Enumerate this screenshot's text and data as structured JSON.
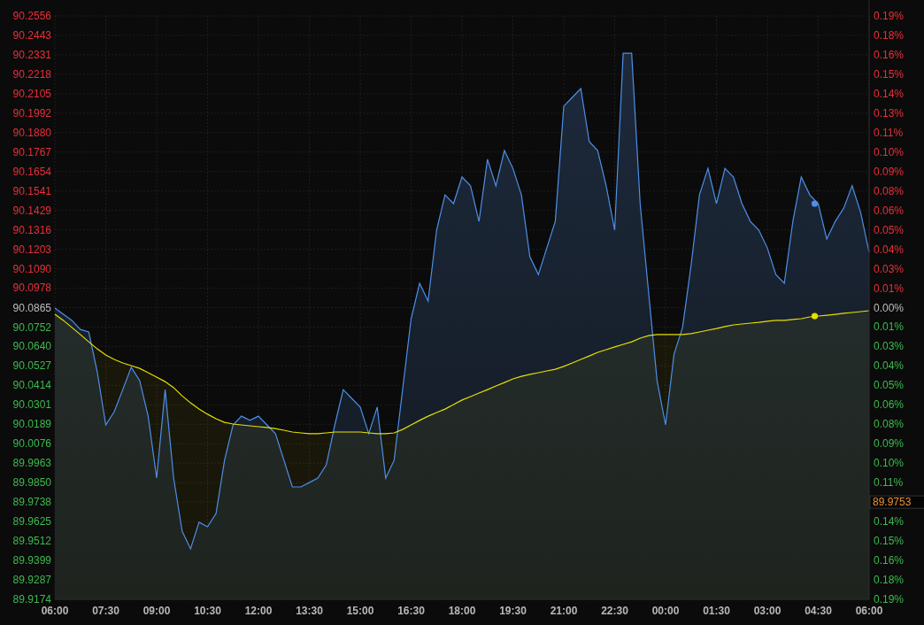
{
  "chart": {
    "chart_data": {
      "type": "area",
      "grid": true,
      "ylim": [
        89.9174,
        90.2556
      ],
      "categories": [
        "06:00",
        null,
        null,
        null,
        null,
        null,
        "07:30",
        null,
        null,
        null,
        null,
        null,
        "09:00",
        null,
        null,
        null,
        null,
        null,
        "10:30",
        null,
        null,
        null,
        null,
        null,
        "12:00",
        null,
        null,
        null,
        null,
        null,
        "13:30",
        null,
        null,
        null,
        null,
        null,
        "15:00",
        null,
        null,
        null,
        null,
        null,
        "16:30",
        null,
        null,
        null,
        null,
        null,
        "18:00",
        null,
        null,
        null,
        null,
        null,
        "19:30",
        null,
        null,
        null,
        null,
        null,
        "21:00",
        null,
        null,
        null,
        null,
        null,
        "22:30",
        null,
        null,
        null,
        null,
        null,
        "00:00",
        null,
        null,
        null,
        null,
        null,
        "01:30",
        null,
        null,
        null,
        null,
        null,
        "03:00",
        null,
        null,
        null,
        null,
        null,
        "04:30",
        null,
        null,
        null,
        null,
        null,
        "06:00"
      ],
      "yticks": [
        {
          "value": 90.2556,
          "label": "90.2556"
        },
        {
          "value": 90.2443,
          "label": "90.2443"
        },
        {
          "value": 90.2331,
          "label": "90.2331"
        },
        {
          "value": 90.2218,
          "label": "90.2218"
        },
        {
          "value": 90.2105,
          "label": "90.2105"
        },
        {
          "value": 90.1992,
          "label": "90.1992"
        },
        {
          "value": 90.188,
          "label": "90.1880"
        },
        {
          "value": 90.1767,
          "label": "90.1767"
        },
        {
          "value": 90.1654,
          "label": "90.1654"
        },
        {
          "value": 90.1541,
          "label": "90.1541"
        },
        {
          "value": 90.1429,
          "label": "90.1429"
        },
        {
          "value": 90.1316,
          "label": "90.1316"
        },
        {
          "value": 90.1203,
          "label": "90.1203"
        },
        {
          "value": 90.109,
          "label": "90.1090"
        },
        {
          "value": 90.0978,
          "label": "90.0978"
        },
        {
          "value": 90.0865,
          "label": "90.0865"
        },
        {
          "value": 90.0752,
          "label": "90.0752"
        },
        {
          "value": 90.064,
          "label": "90.0640"
        },
        {
          "value": 90.0527,
          "label": "90.0527"
        },
        {
          "value": 90.0414,
          "label": "90.0414"
        },
        {
          "value": 90.0301,
          "label": "90.0301"
        },
        {
          "value": 90.0189,
          "label": "90.0189"
        },
        {
          "value": 90.0076,
          "label": "90.0076"
        },
        {
          "value": 89.9963,
          "label": "89.9963"
        },
        {
          "value": 89.985,
          "label": "89.9850"
        },
        {
          "value": 89.9738,
          "label": "89.9738"
        },
        {
          "value": 89.9625,
          "label": "89.9625"
        },
        {
          "value": 89.9512,
          "label": "89.9512"
        },
        {
          "value": 89.9399,
          "label": "89.9399"
        },
        {
          "value": 89.9287,
          "label": "89.9287"
        },
        {
          "value": 89.9174,
          "label": "89.9174"
        }
      ],
      "series": [
        {
          "color": "#4d8fe8",
          "values": [
            90.0862,
            90.0827,
            90.0791,
            90.0739,
            90.0724,
            90.0493,
            90.0185,
            90.0262,
            90.039,
            90.0519,
            90.0442,
            90.0236,
            89.9877,
            90.039,
            89.9877,
            89.9569,
            89.9467,
            89.9621,
            89.9595,
            89.9672,
            89.998,
            90.0185,
            90.0236,
            90.0211,
            90.0236,
            90.0185,
            90.0134,
            89.998,
            89.9826,
            89.9826,
            89.9851,
            89.9877,
            89.9954,
            90.0185,
            90.039,
            90.0339,
            90.0288,
            90.0134,
            90.0288,
            89.9877,
            89.998,
            90.039,
            90.0801,
            90.1006,
            90.0903,
            90.1314,
            90.1519,
            90.1468,
            90.1622,
            90.1571,
            90.1365,
            90.1725,
            90.1571,
            90.1776,
            90.1673,
            90.1519,
            90.116,
            90.1057,
            90.1211,
            90.1365,
            90.2033,
            90.2084,
            90.2135,
            90.1827,
            90.1776,
            90.1571,
            90.1314,
            90.234,
            90.234,
            90.1468,
            90.0955,
            90.0442,
            90.0185,
            90.0596,
            90.075,
            90.1109,
            90.1519,
            90.1673,
            90.1468,
            90.1673,
            90.1622,
            90.1468,
            90.1365,
            90.1314,
            90.1211,
            90.1057,
            90.1006,
            90.1365,
            90.1622,
            90.1519,
            90.1468,
            90.1263,
            90.1365,
            90.1442,
            90.1571,
            90.1417,
            90.1186
          ]
        },
        {
          "color": "#e6e000",
          "values": [
            90.0826,
            90.0791,
            90.075,
            90.0709,
            90.0667,
            90.0626,
            90.059,
            90.0565,
            90.0544,
            90.0529,
            90.0513,
            90.0488,
            90.0462,
            90.0436,
            90.0401,
            90.0354,
            90.0313,
            90.0277,
            90.0247,
            90.0221,
            90.02,
            90.019,
            90.0185,
            90.018,
            90.0175,
            90.017,
            90.0164,
            90.0154,
            90.0144,
            90.0139,
            90.0134,
            90.0134,
            90.0139,
            90.0144,
            90.0144,
            90.0144,
            90.0144,
            90.0139,
            90.0134,
            90.0134,
            90.0139,
            90.0159,
            90.0185,
            90.0211,
            90.0236,
            90.0257,
            90.0277,
            90.0303,
            90.0329,
            90.0349,
            90.037,
            90.039,
            90.0411,
            90.0431,
            90.0452,
            90.0467,
            90.0478,
            90.0488,
            90.0498,
            90.0508,
            90.0524,
            90.0544,
            90.0565,
            90.0585,
            90.0606,
            90.0621,
            90.0637,
            90.0652,
            90.0667,
            90.0688,
            90.0703,
            90.0709,
            90.0709,
            90.0709,
            90.0709,
            90.0714,
            90.0724,
            90.0734,
            90.0744,
            90.0755,
            90.0765,
            90.077,
            90.0775,
            90.078,
            90.0786,
            90.0791,
            90.0791,
            90.0796,
            90.0801,
            90.0811,
            90.0816,
            90.0821,
            90.0826,
            90.0832,
            90.0837,
            90.0842,
            90.0847
          ]
        }
      ],
      "annotations": [
        {
          "x": "04:30"
        }
      ]
    },
    "right_axis": [
      {
        "kind": "up",
        "label": "0.19%"
      },
      {
        "kind": "up",
        "label": "0.18%"
      },
      {
        "kind": "up",
        "label": "0.16%"
      },
      {
        "kind": "up",
        "label": "0.15%"
      },
      {
        "kind": "up",
        "label": "0.14%"
      },
      {
        "kind": "up",
        "label": "0.13%"
      },
      {
        "kind": "up",
        "label": "0.11%"
      },
      {
        "kind": "up",
        "label": "0.10%"
      },
      {
        "kind": "up",
        "label": "0.09%"
      },
      {
        "kind": "up",
        "label": "0.08%"
      },
      {
        "kind": "up",
        "label": "0.06%"
      },
      {
        "kind": "up",
        "label": "0.05%"
      },
      {
        "kind": "up",
        "label": "0.04%"
      },
      {
        "kind": "up",
        "label": "0.03%"
      },
      {
        "kind": "up",
        "label": "0.01%"
      },
      {
        "kind": "flat",
        "label": "0.00%"
      },
      {
        "kind": "down",
        "label": "0.01%"
      },
      {
        "kind": "down",
        "label": "0.03%"
      },
      {
        "kind": "down",
        "label": "0.04%"
      },
      {
        "kind": "down",
        "label": "0.05%"
      },
      {
        "kind": "down",
        "label": "0.06%"
      },
      {
        "kind": "down",
        "label": "0.08%"
      },
      {
        "kind": "down",
        "label": "0.09%"
      },
      {
        "kind": "down",
        "label": "0.10%"
      },
      {
        "kind": "down",
        "label": "0.11%"
      },
      {
        "kind": "price-tag",
        "label": "89.9753"
      },
      {
        "kind": "down",
        "label": "0.14%"
      },
      {
        "kind": "down",
        "label": "0.15%"
      },
      {
        "kind": "down",
        "label": "0.16%"
      },
      {
        "kind": "down",
        "label": "0.18%"
      },
      {
        "kind": "down",
        "label": "0.19%"
      }
    ]
  }
}
